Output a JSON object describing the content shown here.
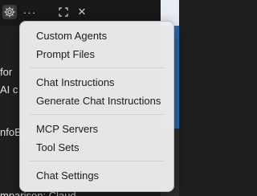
{
  "toolbar": {
    "icons": [
      "gear-icon",
      "more-icon",
      "maximize-icon",
      "close-icon"
    ],
    "more_label": "···",
    "close_label": "✕"
  },
  "background": {
    "lines": [
      "for",
      "AI c",
      "nfoB",
      "mparison: Claud"
    ]
  },
  "menu": {
    "group1": [
      "Custom Agents",
      "Prompt Files"
    ],
    "group2": [
      "Chat Instructions",
      "Generate Chat Instructions"
    ],
    "group3": [
      "MCP Servers",
      "Tool Sets"
    ],
    "group4": [
      "Chat Settings"
    ]
  }
}
